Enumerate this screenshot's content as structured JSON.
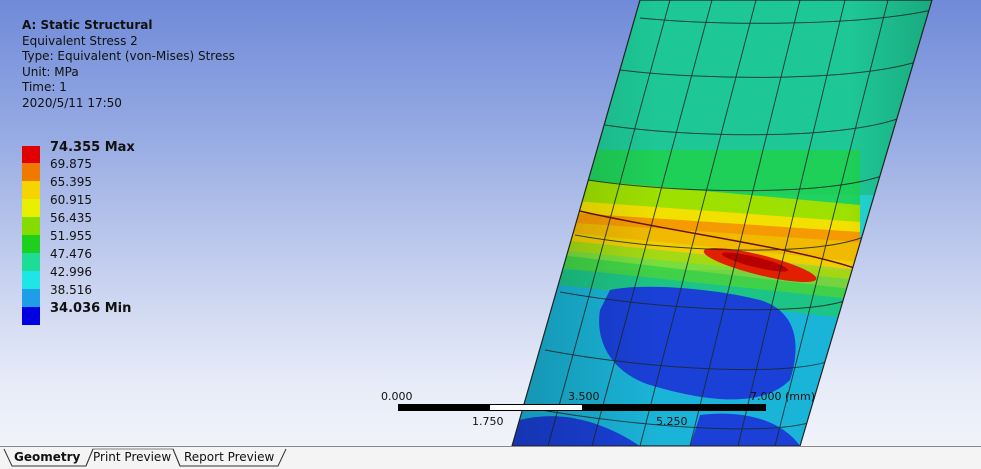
{
  "info": {
    "title": "A: Static Structural",
    "result": "Equivalent Stress 2",
    "type": "Type: Equivalent (von-Mises) Stress",
    "unit": "Unit: MPa",
    "time": "Time: 1",
    "timestamp": "2020/5/11 17:50"
  },
  "legend": {
    "entries": [
      {
        "label": "74.355 Max",
        "color": "#e00000",
        "bold": true
      },
      {
        "label": "69.875",
        "color": "#f07a00",
        "bold": false
      },
      {
        "label": "65.395",
        "color": "#f5d400",
        "bold": false
      },
      {
        "label": "60.915",
        "color": "#e6f000",
        "bold": false
      },
      {
        "label": "56.435",
        "color": "#86dc00",
        "bold": false
      },
      {
        "label": "51.955",
        "color": "#1ed01e",
        "bold": false
      },
      {
        "label": "47.476",
        "color": "#1edc96",
        "bold": false
      },
      {
        "label": "42.996",
        "color": "#1ee6e6",
        "bold": false
      },
      {
        "label": "38.516",
        "color": "#1e9ee6",
        "bold": false
      },
      {
        "label": "34.036 Min",
        "color": "#0000e0",
        "bold": true
      }
    ]
  },
  "scale": {
    "labels_top": [
      "0.000",
      "3.500",
      "7.000 (mm)"
    ],
    "labels_bottom": [
      "1.750",
      "5.250"
    ]
  },
  "tabs": [
    {
      "label": "Geometry",
      "active": true
    },
    {
      "label": "Print Preview",
      "active": false
    },
    {
      "label": "Report Preview",
      "active": false
    }
  ]
}
